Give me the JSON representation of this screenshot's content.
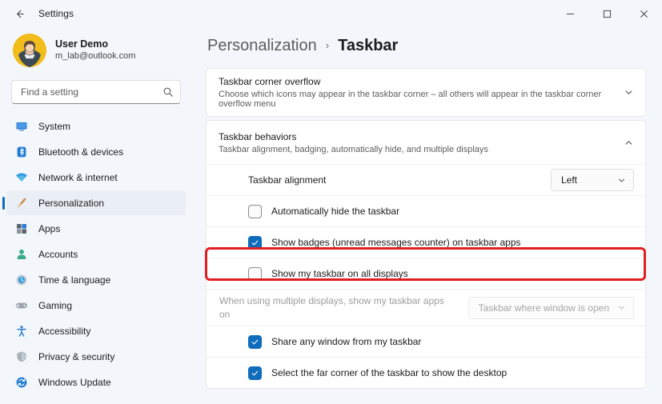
{
  "window": {
    "app_title": "Settings",
    "back_icon": "back-arrow-icon",
    "controls": {
      "minimize": "minimize-icon",
      "maximize": "maximize-icon",
      "close": "close-icon"
    }
  },
  "sidebar": {
    "account": {
      "name": "User Demo",
      "email": "m_lab@outlook.com",
      "avatar_color": "#f2bc1b"
    },
    "search": {
      "placeholder": "Find a setting",
      "value": "",
      "icon": "search-icon"
    },
    "items": [
      {
        "label": "System",
        "icon": "monitor-icon",
        "selected": false
      },
      {
        "label": "Bluetooth & devices",
        "icon": "bluetooth-icon",
        "selected": false
      },
      {
        "label": "Network & internet",
        "icon": "wifi-icon",
        "selected": false
      },
      {
        "label": "Personalization",
        "icon": "paintbrush-icon",
        "selected": true
      },
      {
        "label": "Apps",
        "icon": "apps-icon",
        "selected": false
      },
      {
        "label": "Accounts",
        "icon": "person-icon",
        "selected": false
      },
      {
        "label": "Time & language",
        "icon": "clock-globe-icon",
        "selected": false
      },
      {
        "label": "Gaming",
        "icon": "gamepad-icon",
        "selected": false
      },
      {
        "label": "Accessibility",
        "icon": "accessibility-icon",
        "selected": false
      },
      {
        "label": "Privacy & security",
        "icon": "shield-icon",
        "selected": false
      },
      {
        "label": "Windows Update",
        "icon": "update-icon",
        "selected": false
      }
    ]
  },
  "main": {
    "breadcrumb": {
      "parent": "Personalization",
      "separator": "›",
      "current": "Taskbar"
    },
    "sections": [
      {
        "title": "Taskbar corner overflow",
        "subtitle": "Choose which icons may appear in the taskbar corner – all others will appear in the taskbar corner overflow menu",
        "expanded": false,
        "chevron": "chevron-down-icon"
      },
      {
        "title": "Taskbar behaviors",
        "subtitle": "Taskbar alignment, badging, automatically hide, and multiple displays",
        "expanded": true,
        "chevron": "chevron-up-icon"
      }
    ],
    "behaviors": {
      "alignment": {
        "label": "Taskbar alignment",
        "value": "Left",
        "chevron": "chevron-down-icon"
      },
      "auto_hide": {
        "label": "Automatically hide the taskbar",
        "checked": false,
        "enabled": true
      },
      "badges": {
        "label": "Show badges (unread messages counter) on taskbar apps",
        "checked": true,
        "enabled": true
      },
      "all_displays": {
        "label": "Show my taskbar on all displays",
        "checked": false,
        "enabled": true,
        "highlighted": true
      },
      "multi_display_apps": {
        "label": "When using multiple displays, show my taskbar apps on",
        "value": "Taskbar where window is open",
        "enabled": false,
        "chevron": "chevron-down-icon"
      },
      "share_window": {
        "label": "Share any window from my taskbar",
        "checked": true,
        "enabled": true
      },
      "far_corner": {
        "label": "Select the far corner of the taskbar to show the desktop",
        "checked": true,
        "enabled": true
      }
    }
  },
  "annotation": {
    "highlight_color": "#e02020",
    "target": "Show my taskbar on all displays"
  }
}
